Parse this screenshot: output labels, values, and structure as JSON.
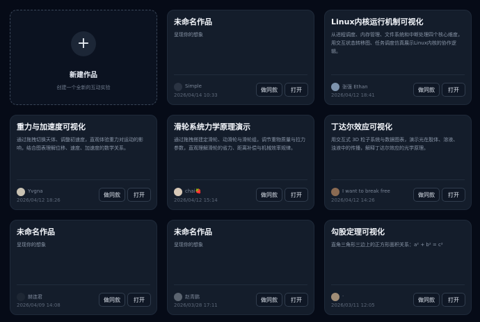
{
  "new_card": {
    "icon": "plus-icon",
    "title": "新建作品",
    "subtitle": "创建一个全新的互动实验"
  },
  "buttons": {
    "same_style": "做同款",
    "open": "打开"
  },
  "cards": [
    {
      "title": "未命名作品",
      "description": "呈现你的想象",
      "author": "Simple",
      "date": "2026/04/14 10:33",
      "avatar_color": "#2a3342"
    },
    {
      "title": "Linux内核运行机制可视化",
      "description": "从进程调度、内存管理、文件系统和中断处理四个核心维度，用交互状态转移图、任务调度仿真展示Linux内核的协作逻辑。",
      "author": "张强 Ethan",
      "date": "2026/04/12 18:41",
      "avatar_color": "#7d93ad"
    },
    {
      "title": "重力与加速度可视化",
      "description": "通过拖拽切换天体、调整初速度，直观体验重力对运动的影响，结合图表理解位移、速度、加速度的数学关系。",
      "author": "Yvgna",
      "date": "2026/04/12 18:26",
      "avatar_color": "#c9c2b3"
    },
    {
      "title": "滑轮系统力学原理演示",
      "description": "通过拖拽搭建定滑轮、动滑轮与滑轮组，调节重物质量与拉力参数，直观理解滑轮的省力、距离补偿与机械效率规律。",
      "author": "chai🍓",
      "date": "2026/04/12 15:14",
      "avatar_color": "#d8c9b8"
    },
    {
      "title": "丁达尔效应可视化",
      "description": "用交互式 3D 粒子系统与数据图表，演示光在胶体、溶液、浊液中的传播，解释丁达尔效应的光学原理。",
      "author": "I want to break free",
      "date": "2026/04/12 14:26",
      "avatar_color": "#8a6a52"
    },
    {
      "title": "未命名作品",
      "description": "呈现你的想象",
      "author": "赫连君",
      "date": "2026/04/09 14:08",
      "avatar_color": "#1e2734"
    },
    {
      "title": "未命名作品",
      "description": "呈现你的想象",
      "author": "赵青鹏",
      "date": "2026/03/28 17:11",
      "avatar_color": "#5b6470"
    },
    {
      "title": "勾股定理可视化",
      "description": "直角三角形三边上的正方形面积关系：a² + b² = c²",
      "author": "·",
      "date": "2026/03/11 12:05",
      "avatar_color": "#a08d76"
    }
  ]
}
